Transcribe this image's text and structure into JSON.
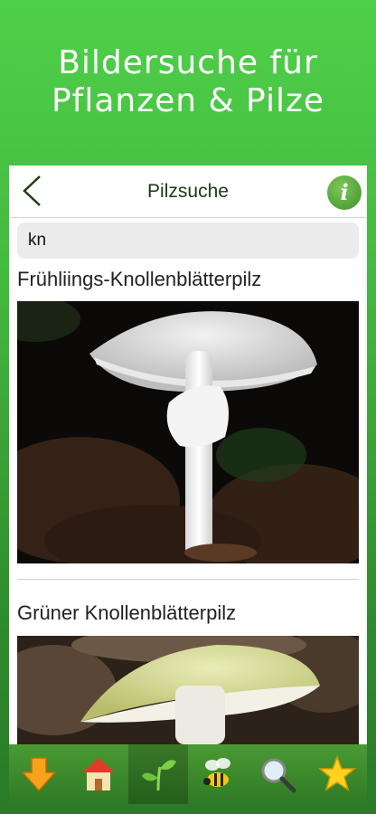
{
  "promo": {
    "line1": "Bildersuche für",
    "line2": "Pflanzen & Pilze"
  },
  "navbar": {
    "title": "Pilzsuche",
    "info_label": "i"
  },
  "search": {
    "value": "kn"
  },
  "results": [
    {
      "title": "Frühliings-Knollenblätterpilz"
    },
    {
      "title": "Grüner Knollenblätterpilz"
    }
  ],
  "tabbar": {
    "active": "tab-plants",
    "tabs": [
      "download-icon",
      "home-icon",
      "plant-icon",
      "bee-icon",
      "search-icon",
      "star-icon"
    ]
  },
  "colors": {
    "brand_green": "#44b83f",
    "tab_green": "#3f8a2e",
    "title_dark": "#1a3a12"
  }
}
